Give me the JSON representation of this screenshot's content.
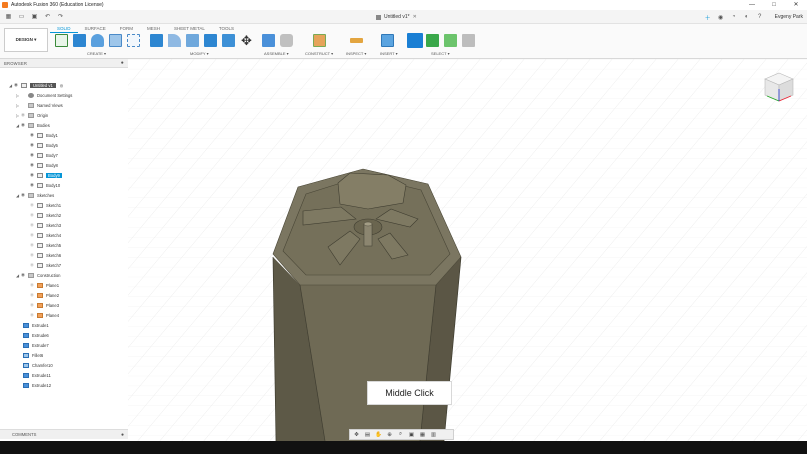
{
  "window": {
    "title": "Autodesk Fusion 360 (Education License)",
    "minimize": "—",
    "maximize": "□",
    "close": "✕"
  },
  "document": {
    "tab_title": "Untitled v1*",
    "tab_close": "✕"
  },
  "account": {
    "user_name": "Evgeny Park"
  },
  "ribbon": {
    "workspace_label": "DESIGN ▾",
    "tabs": [
      "SOLID",
      "SURFACE",
      "FORM",
      "MESH",
      "SHEET METAL",
      "TOOLS"
    ],
    "active_tab": "SOLID",
    "groups": {
      "create": "CREATE ▾",
      "modify": "MODIFY ▾",
      "assemble": "ASSEMBLE ▾",
      "construct": "CONSTRUCT ▾",
      "inspect": "INSPECT ▾",
      "insert": "INSERT ▾",
      "select": "SELECT ▾"
    }
  },
  "browser": {
    "header": "BROWSER",
    "root": "Untitled v1",
    "items": {
      "document_settings": "Document Settings",
      "named_views": "Named Views",
      "origin": "Origin",
      "bodies": "Bodies",
      "body1": "Body1",
      "body5": "Body5",
      "body7": "Body7",
      "body8": "Body8",
      "body9": "Body9",
      "body10": "Body10",
      "sketches": "Sketches",
      "sketch1": "Sketch1",
      "sketch2": "Sketch2",
      "sketch3": "Sketch3",
      "sketch4": "Sketch4",
      "sketch5": "Sketch5",
      "sketch6": "Sketch6",
      "sketch7": "Sketch7",
      "construction": "Construction",
      "plane1": "Plane1",
      "plane2": "Plane2",
      "plane3": "Plane3",
      "plane4": "Plane4",
      "extrude1": "Extrude1",
      "extrude6": "Extrude6",
      "extrude7": "Extrude7",
      "fillet6": "Fillet6",
      "chamfer10": "Chamfer10",
      "extrude11": "Extrude11",
      "extrude12": "Extrude12"
    },
    "selected_item": "Body9"
  },
  "comments": {
    "header": "COMMENTS"
  },
  "viewport": {
    "tooltip": "Middle Click"
  },
  "colors": {
    "accent": "#0696d7",
    "model": "#6f6a55",
    "timeline": "#111111"
  },
  "icons": [
    "apps-grid-icon",
    "file-icon",
    "save-icon",
    "undo-icon",
    "redo-icon",
    "close-icon",
    "add-icon",
    "extensions-icon",
    "job-status-icon",
    "notifications-icon",
    "help-icon",
    "eye-icon",
    "folder-icon",
    "gear-icon",
    "plane-icon",
    "orbit-icon",
    "pan-icon",
    "zoom-icon",
    "display-settings-icon",
    "grid-icon"
  ]
}
